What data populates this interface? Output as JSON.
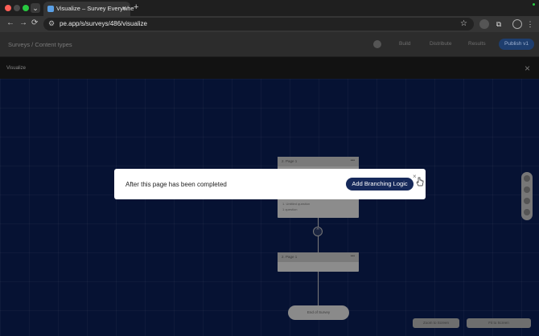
{
  "browser": {
    "tab_title": "Visualize – Survey Everywhe",
    "tab_close": "×",
    "new_tab": "+",
    "url": "pe.app/s/surveys/486/visualize",
    "nav_back": "←",
    "nav_forward": "→",
    "nav_reload": "⟳",
    "bookmark_icon": "☆",
    "menu_icon": "⋮"
  },
  "app": {
    "breadcrumb": "Surveys / Content types",
    "tabs": [
      "Build",
      "Distribute",
      "Results"
    ],
    "publish_label": "Publish v1",
    "panel_title": "Visualize",
    "panel_close": "×"
  },
  "canvas": {
    "page1_label": "2. Page 1",
    "page1_sub1": "1. Untitled question",
    "page1_sub2": "1 question",
    "page2_label": "2. Page 1",
    "end_label": "End of Survey",
    "dots": "•••",
    "node_icon": "⌃",
    "zoom_label": "Zoom to Screen",
    "fit_label": "Fit to Screen"
  },
  "modal": {
    "message": "After this page has been completed",
    "button_label": "Add Branching Logic",
    "close": "×"
  }
}
